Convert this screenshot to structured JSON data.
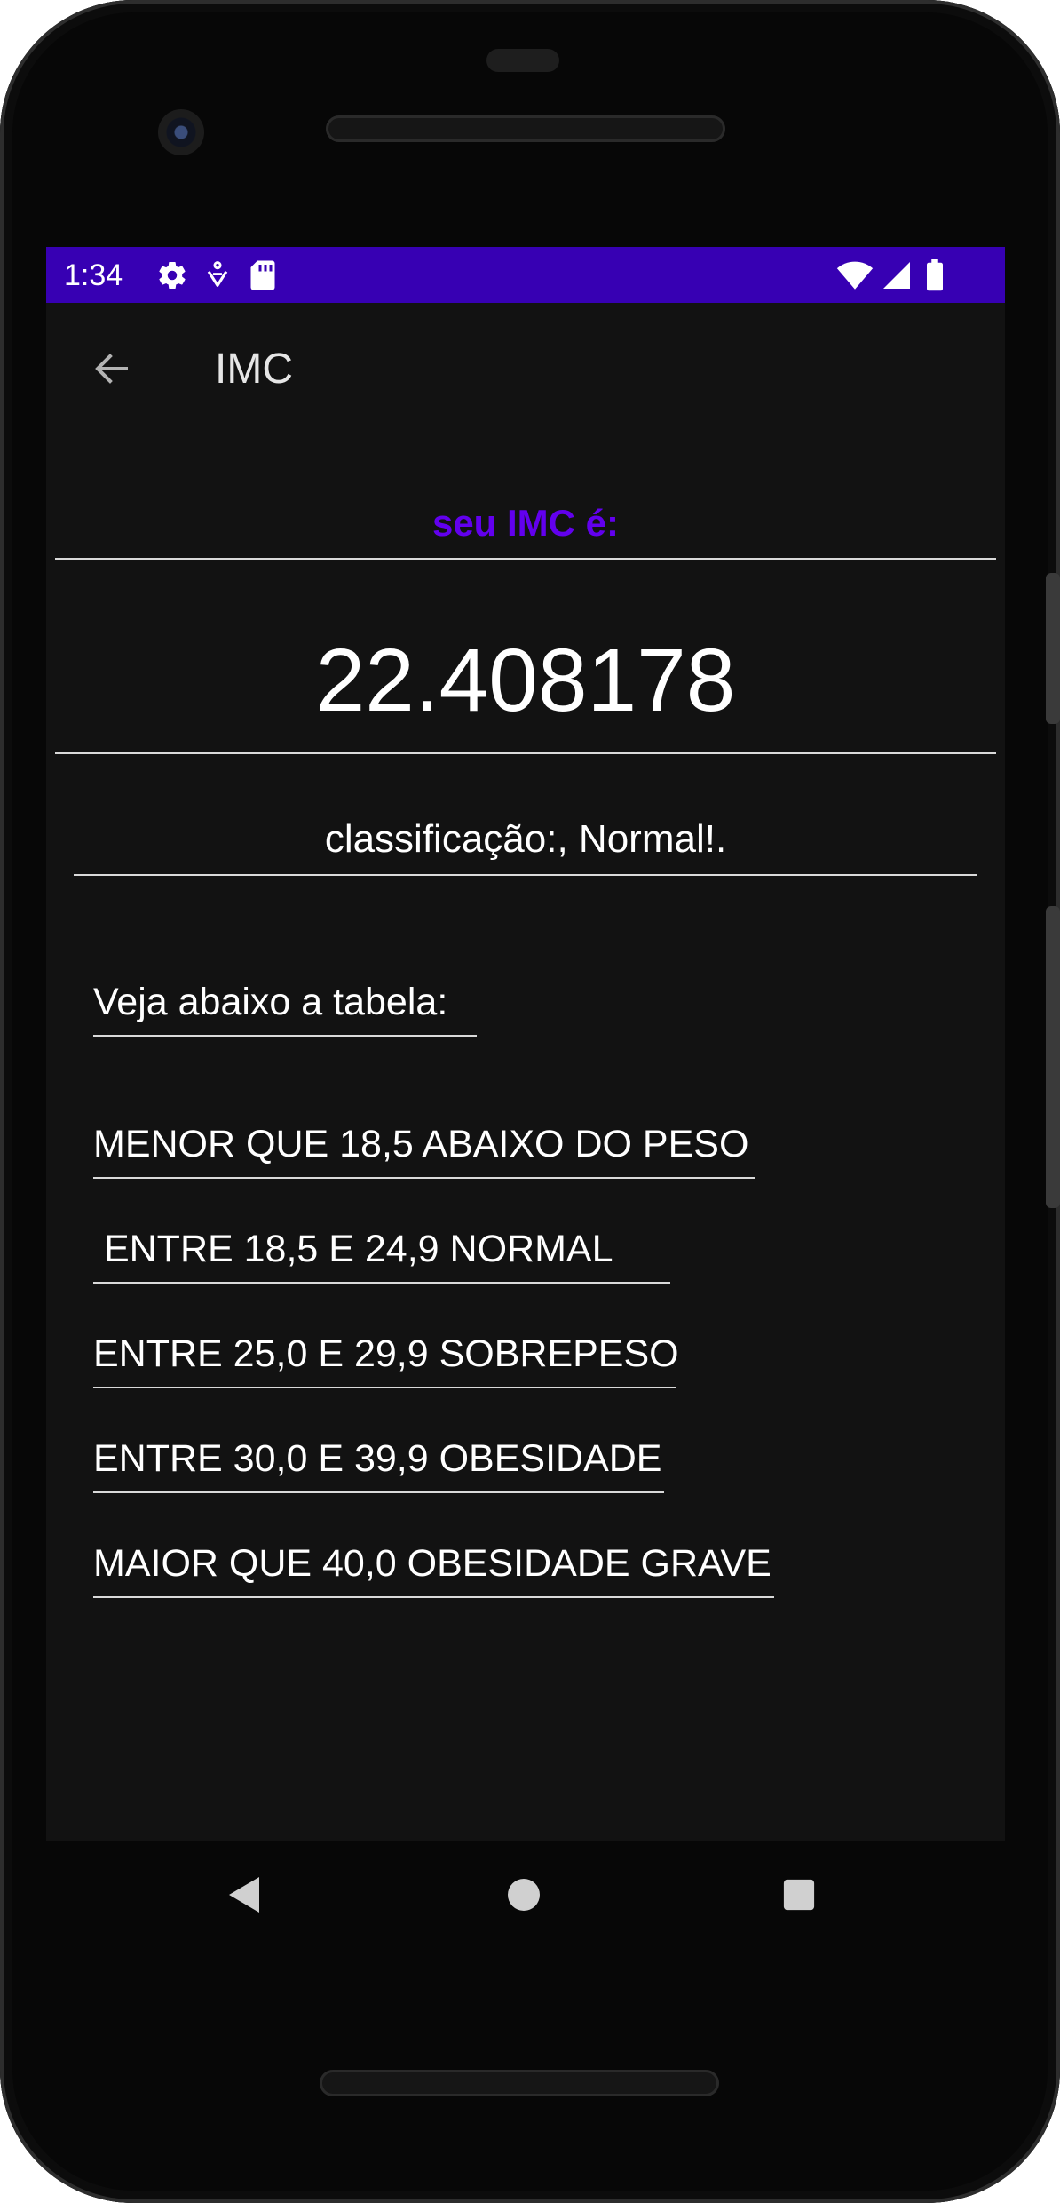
{
  "status_bar": {
    "time": "1:34",
    "background": "#3700b3",
    "left_icons": [
      "settings-icon",
      "accessibility-icon",
      "sd-card-icon"
    ],
    "right_icons": [
      "wifi-icon",
      "signal-icon",
      "battery-icon"
    ]
  },
  "app_bar": {
    "title": "IMC",
    "back_icon": "arrow-back-icon"
  },
  "result": {
    "label": "seu IMC é:",
    "label_color": "#6200ee",
    "value": "22.408178",
    "classification": "classificação:, Normal!."
  },
  "table": {
    "heading": "Veja abaixo a tabela:",
    "items": [
      "MENOR QUE 18,5 ABAIXO DO PESO",
      " ENTRE 18,5 E 24,9 NORMAL",
      "ENTRE 25,0 E 29,9 SOBREPESO",
      "ENTRE 30,0 E 39,9 OBESIDADE",
      "MAIOR QUE 40,0 OBESIDADE GRAVE"
    ]
  },
  "nav_bar": {
    "buttons": [
      "back-triangle-icon",
      "home-circle-icon",
      "recents-square-icon"
    ]
  },
  "colors": {
    "background": "#121212",
    "text": "#ffffff",
    "divider": "#d9d9d9"
  }
}
